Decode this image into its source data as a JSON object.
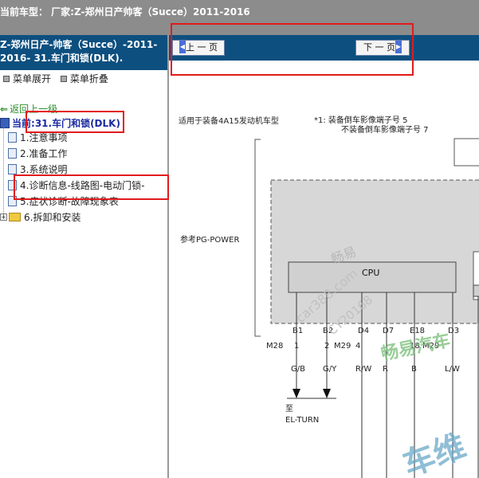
{
  "top_bar": {
    "title": "当前车型：  厂家:Z-郑州日产帅客（Succe）2011-2016"
  },
  "left_panel": {
    "header_line1": "Z-郑州日产-帅客（Succe）-2011-",
    "header_line2": "2016- 31.车门和锁(DLK).",
    "expand_label": "菜单展开",
    "collapse_label": "菜单折叠",
    "back_label": "返回上一级",
    "current_prefix": "当前:",
    "current_value": "31.车门和锁(DLK)",
    "tree_items": [
      {
        "label": "1.注意事项"
      },
      {
        "label": "2.准备工作"
      },
      {
        "label": "3.系统说明"
      },
      {
        "label": "4.诊断信息-线路图-电动门锁-"
      },
      {
        "label": "5.症状诊断-故障现象表"
      },
      {
        "label": "6.拆卸和安装"
      }
    ]
  },
  "nav": {
    "prev_label": "上 一 页",
    "next_label": "下 一 页"
  },
  "diagram": {
    "note_left": "适用于装备4A15发动机车型",
    "note_right1": "*1: 装备倒车影像端子号 5",
    "note_right2": "不装备倒车影像端子号 7",
    "ref_label": "参考PG-POWER",
    "cpu_label": "CPU",
    "pins_top": [
      "B1",
      "B2",
      "D4",
      "D7",
      "E18",
      "D3"
    ],
    "connector_left": "M28",
    "connector_mid": "M29",
    "connector_right": "M29",
    "pin_numbers": [
      "1",
      "2",
      "4",
      "18"
    ],
    "wire_colors": [
      "G/B",
      "G/Y",
      "R/W",
      "R",
      "B",
      "L/W"
    ],
    "dest_prefix": "至",
    "dest_label": "EL-TURN",
    "watermark1": "畅易",
    "watermark2": "car388.com",
    "watermark3": "CY20168",
    "watermark4": "畅易汽车",
    "watermark5": "车维"
  },
  "colors": {
    "header_blue": "#0d4f7f",
    "top_gray": "#8c8c8c",
    "highlight_red": "#e21b1b"
  }
}
